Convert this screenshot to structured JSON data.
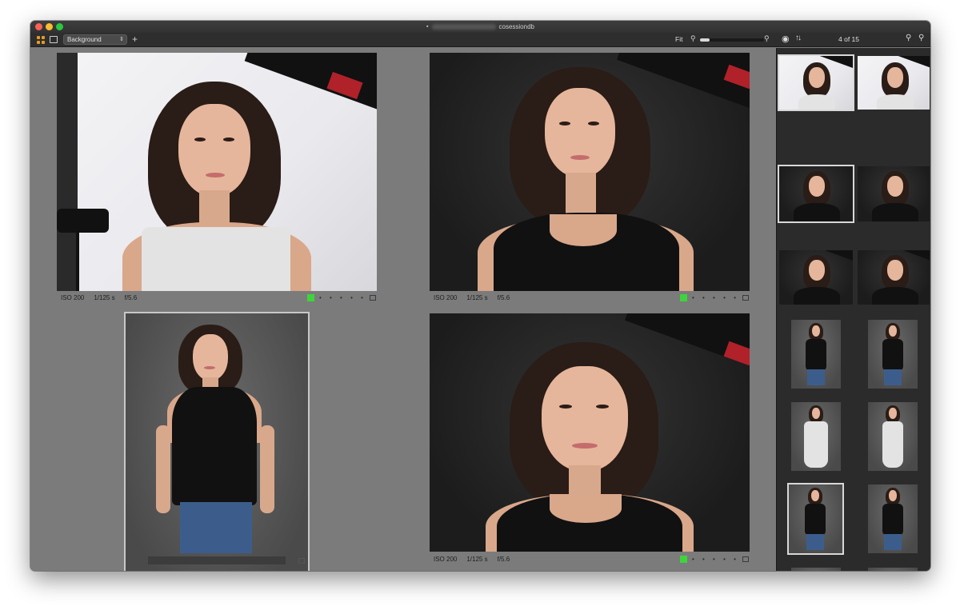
{
  "window": {
    "title": "cosessiondb"
  },
  "toolbar": {
    "preset_label": "Background",
    "fit_label": "Fit",
    "zoom_percent": 15,
    "count_label": "4 of 15"
  },
  "viewer": {
    "photos": [
      {
        "iso": "ISO 200",
        "shutter": "1/125 s",
        "aperture": "f/5.6",
        "tag_color": "#3ed43c",
        "rating_dots": "• • • • •"
      },
      {
        "iso": "ISO 200",
        "shutter": "1/125 s",
        "aperture": "f/5.6",
        "tag_color": "#3ed43c",
        "rating_dots": "• • • • •"
      },
      {
        "iso": "",
        "shutter": "",
        "aperture": ""
      },
      {
        "iso": "ISO 200",
        "shutter": "1/125 s",
        "aperture": "f/5.6",
        "tag_color": "#3ed43c",
        "rating_dots": "• • • • •"
      }
    ]
  },
  "sidebar": {
    "thumbnail_count": 14,
    "selected_index": 10
  },
  "colors": {
    "accent_orange": "#e69b2a",
    "color_tag_green": "#3ed43c",
    "viewer_bg": "#7b7b7b",
    "sidebar_bg": "#2b2b2b"
  }
}
